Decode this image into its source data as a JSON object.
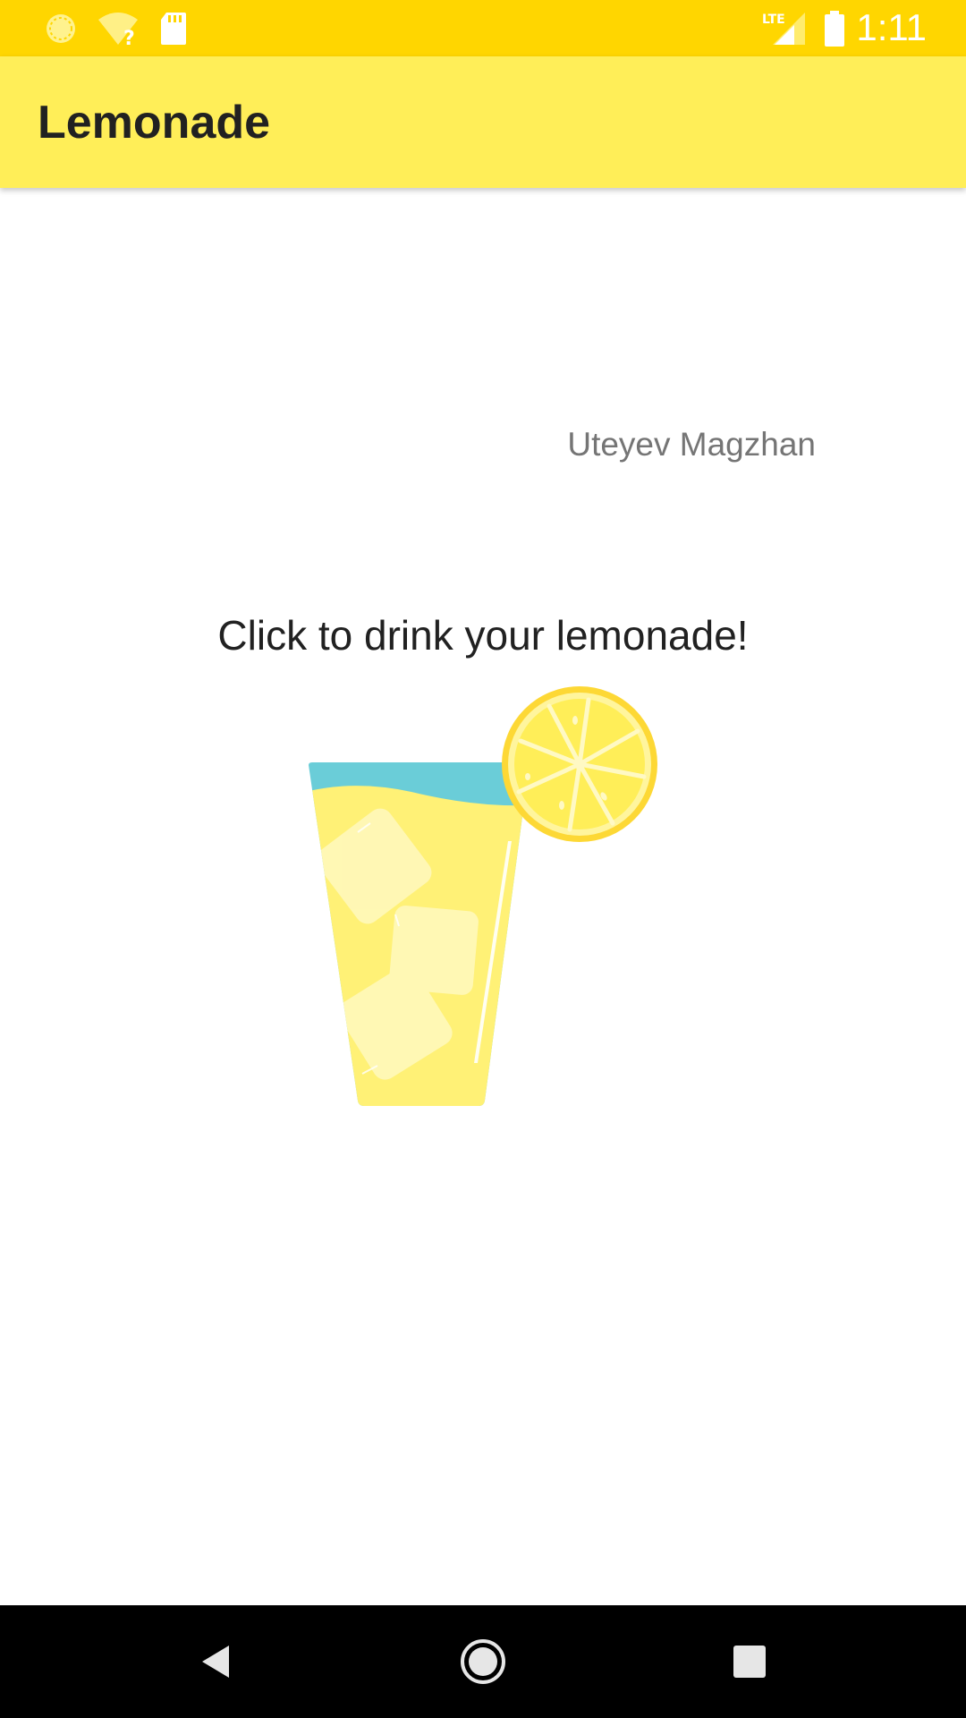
{
  "status_bar": {
    "time": "1:11",
    "network_label": "LTE",
    "icons": [
      "sync-icon",
      "wifi-unknown-icon",
      "sd-card-icon",
      "lte-signal-icon",
      "battery-icon"
    ],
    "background": "#FFD600"
  },
  "app_bar": {
    "title": "Lemonade",
    "background": "#FFEE58"
  },
  "content": {
    "author": "Uteyev Magzhan",
    "instruction": "Click to drink your lemonade!",
    "image": "lemonade-glass-with-lemon-slice"
  },
  "nav_bar": {
    "buttons": [
      "back-button",
      "home-button",
      "recents-button"
    ]
  }
}
